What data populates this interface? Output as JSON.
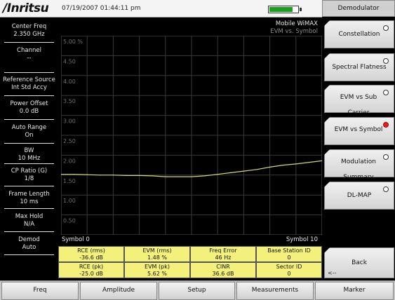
{
  "header": {
    "brand": "/Inritsu",
    "datetime": "07/19/2007 01:44:11 pm",
    "battery_level": 0.78
  },
  "left_panel": [
    {
      "label": "Center Freq",
      "value": "2.350 GHz"
    },
    {
      "label": "Channel",
      "value": "--"
    },
    {
      "label": "Reference Source",
      "value": "Int Std Accy"
    },
    {
      "label": "Power Offset",
      "value": "0.0 dB"
    },
    {
      "label": "Auto Range",
      "value": "On"
    },
    {
      "label": "BW",
      "value": "10 MHz"
    },
    {
      "label": "CP Ratio (G)",
      "value": "1/8"
    },
    {
      "label": "Frame Length",
      "value": "10 ms"
    },
    {
      "label": "Max Hold",
      "value": "N/A"
    },
    {
      "label": "Demod",
      "value": "Auto"
    }
  ],
  "graph": {
    "mode": "Mobile WiMAX",
    "view": "EVM vs. Symbol",
    "x_start_label": "Symbol  0",
    "x_end_label": "Symbol  10"
  },
  "chart_data": {
    "type": "line",
    "title": "EVM vs. Symbol",
    "xlabel": "Symbol",
    "ylabel": "",
    "xlim": [
      0,
      10
    ],
    "ylim": [
      0.0,
      5.0
    ],
    "y_tick_labels": [
      "5.00 %",
      "4.50",
      "4.00",
      "3.50",
      "3.00",
      "2.50",
      "2.00",
      "1.50",
      "1.00",
      "0.50"
    ],
    "grid": true,
    "series": [
      {
        "x": [
          0,
          0.5,
          1,
          1.5,
          2,
          2.5,
          3,
          3.5,
          4,
          4.5,
          5,
          5.5,
          6,
          6.5,
          7,
          7.5,
          8,
          8.5,
          9,
          9.5,
          10
        ],
        "values": [
          1.52,
          1.52,
          1.51,
          1.5,
          1.5,
          1.49,
          1.49,
          1.48,
          1.46,
          1.46,
          1.46,
          1.48,
          1.52,
          1.56,
          1.6,
          1.64,
          1.7,
          1.75,
          1.78,
          1.82,
          1.86
        ],
        "color": "#d8d870"
      }
    ]
  },
  "results": [
    {
      "label": "RCE (rms)",
      "value": "-36.6 dB"
    },
    {
      "label": "EVM (rms)",
      "value": "1.48 %"
    },
    {
      "label": "Freq Error",
      "value": "46 Hz"
    },
    {
      "label": "Base Station ID",
      "value": "0"
    },
    {
      "label": "RCE (pk)",
      "value": "-25.0 dB"
    },
    {
      "label": "EVM (pk)",
      "value": "5.62 %"
    },
    {
      "label": "CINR",
      "value": "36.6 dB"
    },
    {
      "label": "Sector ID",
      "value": "0"
    }
  ],
  "right_panel": {
    "title": "Demodulator",
    "keys": [
      {
        "label": "Constellation",
        "selected": false
      },
      {
        "label": "Spectral Flatness",
        "selected": false
      },
      {
        "label": "EVM vs Sub Carrier",
        "selected": false
      },
      {
        "label": "EVM vs Symbol",
        "selected": true
      },
      {
        "label": "Modulation Summary",
        "selected": false
      },
      {
        "label": "DL-MAP",
        "selected": false
      }
    ],
    "back_label": "Back",
    "back_sub": "<--"
  },
  "bottom_bar": [
    "Freq",
    "Amplitude",
    "Setup",
    "Measurements",
    "Marker"
  ],
  "colors": {
    "trace": "#d8d870",
    "result_bg": "#f3f17c",
    "grid": "#3a3a3a"
  }
}
